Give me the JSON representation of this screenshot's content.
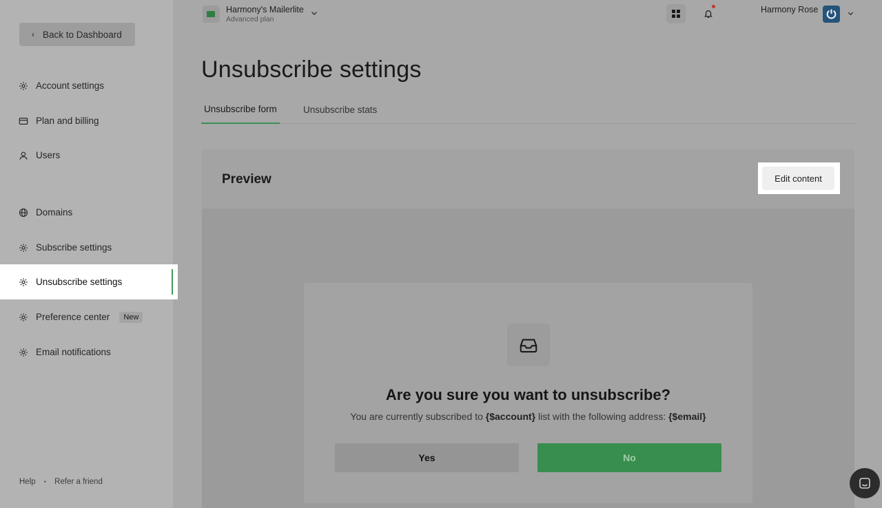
{
  "sidebar": {
    "back_label": "Back to Dashboard",
    "items": [
      {
        "label": "Account settings",
        "icon": "gear-icon"
      },
      {
        "label": "Plan and billing",
        "icon": "credit-card-icon"
      },
      {
        "label": "Users",
        "icon": "user-icon"
      },
      {
        "label": "Domains",
        "icon": "globe-icon"
      },
      {
        "label": "Subscribe settings",
        "icon": "gear-icon"
      },
      {
        "label": "Unsubscribe settings",
        "icon": "gear-icon",
        "active": true
      },
      {
        "label": "Preference center",
        "icon": "gear-icon",
        "badge": "New"
      },
      {
        "label": "Email notifications",
        "icon": "gear-icon"
      }
    ],
    "footer": {
      "help": "Help",
      "refer": "Refer a friend"
    }
  },
  "header": {
    "account_name": "Harmony's Mailerlite",
    "account_plan": "Advanced plan",
    "user_name": "Harmony Rose"
  },
  "main": {
    "title": "Unsubscribe settings",
    "tabs": [
      {
        "label": "Unsubscribe form",
        "active": true
      },
      {
        "label": "Unsubscribe stats",
        "active": false
      }
    ],
    "preview": {
      "title": "Preview",
      "edit_label": "Edit content",
      "form": {
        "question": "Are you sure you want to unsubscribe?",
        "sub_prefix": "You are currently subscribed to ",
        "sub_account": "{$account}",
        "sub_middle": " list with the following address: ",
        "sub_email": "{$email}",
        "yes_label": "Yes",
        "no_label": "No"
      }
    }
  },
  "colors": {
    "accent": "#3a8f52",
    "active_bg": "#ffffff",
    "notification": "#c0392b"
  }
}
